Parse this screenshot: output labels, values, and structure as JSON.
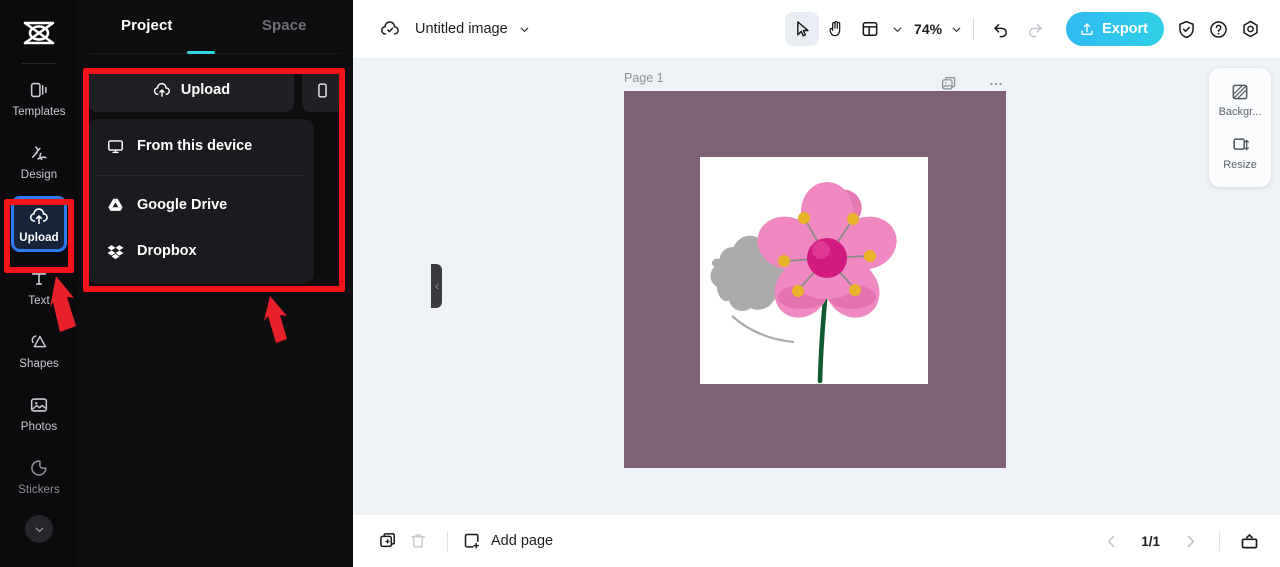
{
  "rail": {
    "logo_icon": "capcut-logo-icon",
    "items": [
      {
        "id": "templates",
        "label": "Templates",
        "icon": "templates-icon",
        "state": "normal"
      },
      {
        "id": "design",
        "label": "Design",
        "icon": "design-icon",
        "state": "normal"
      },
      {
        "id": "upload",
        "label": "Upload",
        "icon": "upload-cloud-icon",
        "state": "active"
      },
      {
        "id": "text",
        "label": "Text",
        "icon": "text-icon",
        "state": "normal"
      },
      {
        "id": "shapes",
        "label": "Shapes",
        "icon": "shapes-icon",
        "state": "normal"
      },
      {
        "id": "photos",
        "label": "Photos",
        "icon": "photos-icon",
        "state": "normal"
      },
      {
        "id": "stickers",
        "label": "Stickers",
        "icon": "stickers-icon",
        "state": "dim"
      }
    ],
    "expand_icon": "chevron-down-icon"
  },
  "panel": {
    "tabs": [
      {
        "id": "project",
        "label": "Project",
        "active": true
      },
      {
        "id": "space",
        "label": "Space",
        "active": false
      }
    ],
    "upload_button": {
      "label": "Upload",
      "icon": "upload-cloud-icon"
    },
    "phone_button": {
      "icon": "mobile-phone-icon"
    },
    "menu": [
      {
        "id": "from-this-device",
        "label": "From this device",
        "icon": "monitor-icon"
      },
      {
        "id": "google-drive",
        "label": "Google Drive",
        "icon": "google-drive-icon"
      },
      {
        "id": "dropbox",
        "label": "Dropbox",
        "icon": "dropbox-icon"
      }
    ],
    "collapse_icon": "chevron-left-icon"
  },
  "annotations": {
    "highlight_color": "#f4131b",
    "boxes": [
      "upload-rail-button",
      "upload-panel-section"
    ],
    "arrows": [
      "arrow-to-upload-rail-button",
      "arrow-to-upload-panel"
    ]
  },
  "topbar": {
    "cloud_icon": "cloud-saved-icon",
    "doc_title": "Untitled image",
    "title_chevron_icon": "chevron-down-icon",
    "tools": [
      {
        "id": "select",
        "icon": "cursor-arrow-icon",
        "selected": true
      },
      {
        "id": "hand",
        "icon": "hand-icon",
        "selected": false
      },
      {
        "id": "layout",
        "icon": "layout-icon",
        "selected": false
      }
    ],
    "layout_chevron_icon": "chevron-down-icon",
    "zoom_level": "74%",
    "zoom_chevron_icon": "chevron-down-icon",
    "undo_icon": "undo-icon",
    "redo_icon": "redo-icon",
    "export_button": {
      "label": "Export",
      "icon": "export-upload-icon",
      "color": "#2fc3e8"
    },
    "right_icons": [
      {
        "id": "shield",
        "icon": "shield-check-icon"
      },
      {
        "id": "help",
        "icon": "question-circle-icon"
      },
      {
        "id": "settings",
        "icon": "gear-icon"
      }
    ]
  },
  "canvas": {
    "page_label": "Page 1",
    "page_icons": [
      {
        "id": "duplicate-page",
        "icon": "duplicate-image-icon"
      },
      {
        "id": "page-more",
        "icon": "more-horizontal-icon"
      }
    ],
    "page_background_color": "#806077",
    "artboard_background_color": "#ffffff",
    "artwork": {
      "name": "pink-flower-3d",
      "petal_color": "#f089c2",
      "petal_shade_color": "#e06aaa",
      "center_color": "#d31a7e",
      "stamen_color": "#e8b42a",
      "stem_color": "#0f5a2e",
      "shadow_color": "#9d9d9d"
    }
  },
  "rightdock": {
    "items": [
      {
        "id": "background",
        "label": "Backgr...",
        "icon": "background-pattern-icon"
      },
      {
        "id": "resize",
        "label": "Resize",
        "icon": "resize-icon"
      }
    ]
  },
  "bottombar": {
    "duplicate_icon": "duplicate-page-icon",
    "delete_icon": "trash-icon",
    "add_page": {
      "label": "Add page",
      "icon": "add-page-icon"
    },
    "prev_icon": "chevron-left-icon",
    "page_indicator": "1/1",
    "next_icon": "chevron-right-icon",
    "present_icon": "present-icon"
  }
}
